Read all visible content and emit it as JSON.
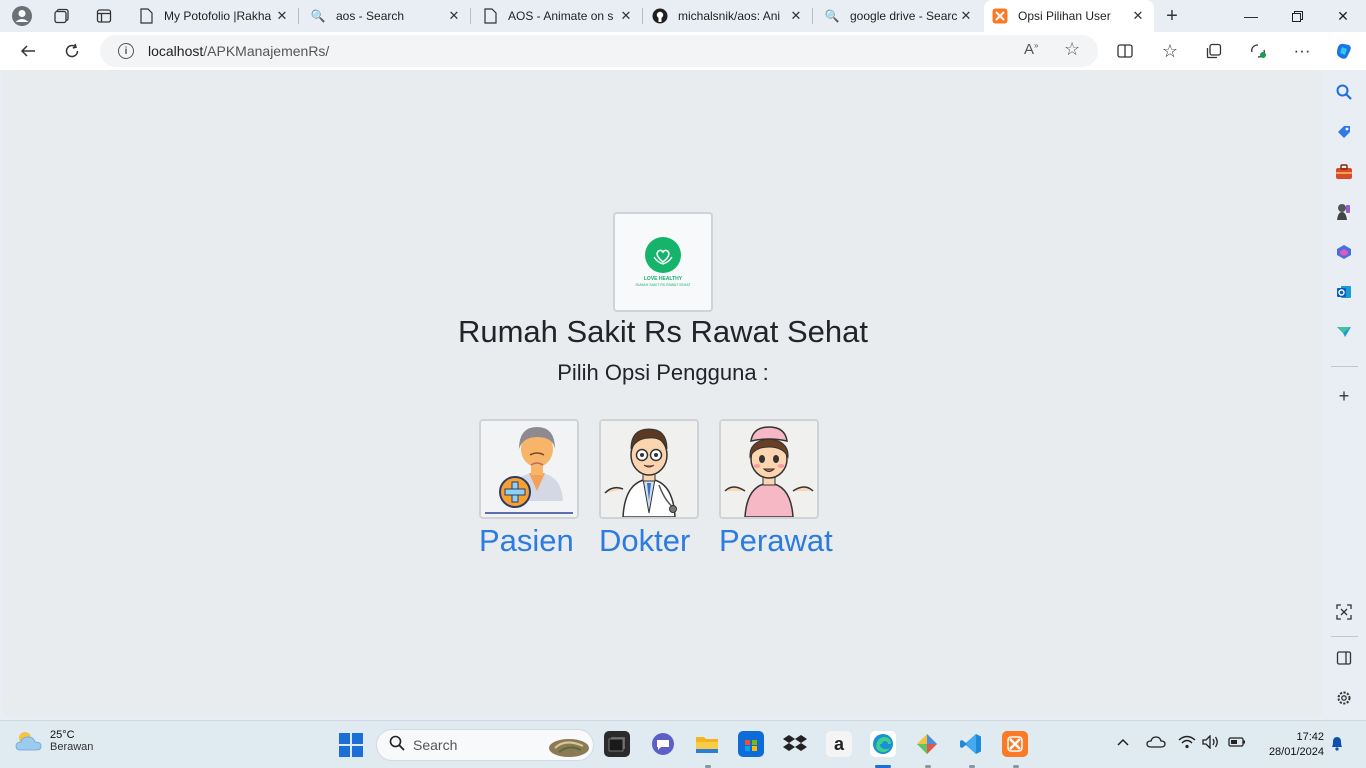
{
  "browser": {
    "tabs": [
      {
        "title": "My Potofolio |Rakha",
        "icon": "page-icon"
      },
      {
        "title": "aos - Search",
        "icon": "search-icon"
      },
      {
        "title": "AOS - Animate on s",
        "icon": "page-icon"
      },
      {
        "title": "michalsnik/aos: Ani",
        "icon": "github-icon"
      },
      {
        "title": "google drive - Searc",
        "icon": "search-icon"
      },
      {
        "title": "Opsi Pilihan User",
        "icon": "xampp-icon",
        "active": true
      }
    ],
    "url_host": "localhost",
    "url_path": "/APKManajemenRs/"
  },
  "page": {
    "logo_text": "LOVE HEALTHY",
    "logo_subtext": "RUMAH SAKIT RS RAWAT SEHAT",
    "title": "Rumah Sakit Rs Rawat Sehat",
    "subtitle": "Pilih Opsi Pengguna :",
    "options": [
      {
        "label": "Pasien"
      },
      {
        "label": "Dokter"
      },
      {
        "label": "Perawat"
      }
    ],
    "link_color": "#2b7be0"
  },
  "taskbar": {
    "temperature": "25°C",
    "weather": "Berawan",
    "search_placeholder": "Search",
    "time": "17:42",
    "date": "28/01/2024"
  }
}
